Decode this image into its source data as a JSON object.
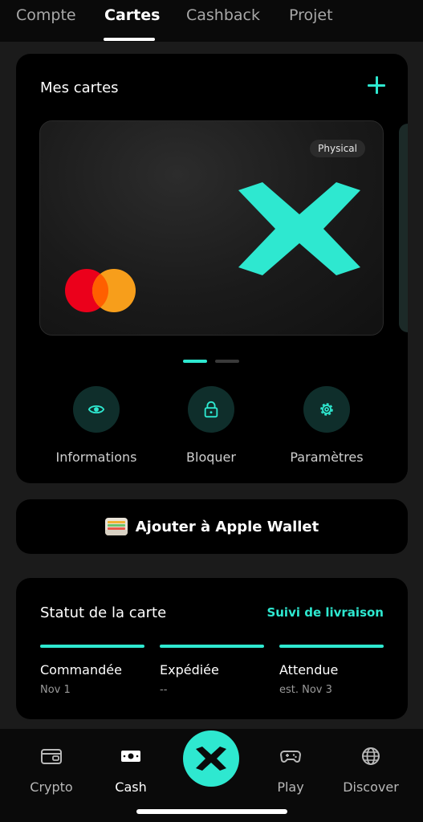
{
  "colors": {
    "accent": "#2ee8d0",
    "background": "#1b1b1b",
    "panel": "#000000"
  },
  "top_tabs": [
    {
      "label": "Compte",
      "active": false
    },
    {
      "label": "Cartes",
      "active": true
    },
    {
      "label": "Cashback",
      "active": false
    },
    {
      "label": "Projet",
      "active": false
    }
  ],
  "cards": {
    "title": "Mes cartes",
    "add_icon": "plus-icon",
    "card": {
      "badge": "Physical",
      "logo": "x-logo",
      "network": "mastercard-logo"
    },
    "carousel_page": 1,
    "carousel_total": 2
  },
  "actions": [
    {
      "label": "Informations",
      "icon": "eye-icon"
    },
    {
      "label": "Bloquer",
      "icon": "lock-icon"
    },
    {
      "label": "Paramètres",
      "icon": "gear-icon"
    }
  ],
  "wallet": {
    "label": "Ajouter à Apple Wallet",
    "icon": "apple-wallet-icon"
  },
  "status": {
    "title": "Statut de la carte",
    "link": "Suivi de livraison",
    "steps": [
      {
        "label": "Commandée",
        "date": "Nov 1"
      },
      {
        "label": "Expédiée",
        "date": "--"
      },
      {
        "label": "Attendue",
        "date": "est. Nov 3"
      }
    ]
  },
  "bottom_nav": [
    {
      "label": "Crypto",
      "icon": "wallet-icon",
      "active": false
    },
    {
      "label": "Cash",
      "icon": "banknote-icon",
      "active": true
    },
    {
      "label": "",
      "icon": "x-logo-icon",
      "active": false
    },
    {
      "label": "Play",
      "icon": "gamepad-icon",
      "active": false
    },
    {
      "label": "Discover",
      "icon": "globe-icon",
      "active": false
    }
  ]
}
